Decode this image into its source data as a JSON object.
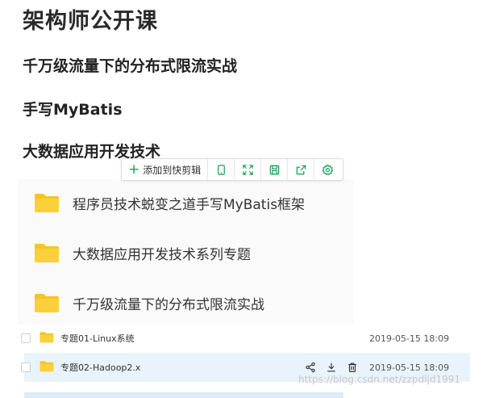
{
  "headings": {
    "title": "架构师公开课",
    "h2a": "千万级流量下的分布式限流实战",
    "h2b": "手写MyBatis",
    "h2c": "大数据应用开发技术"
  },
  "toolbar": {
    "add_label": "添加到快剪辑"
  },
  "folders": [
    {
      "label": "程序员技术蜕变之道手写MyBatis框架"
    },
    {
      "label": "大数据应用开发技术系列专题"
    },
    {
      "label": "千万级流量下的分布式限流实战"
    }
  ],
  "files": [
    {
      "name": "专题01-Linux系统",
      "date": "2019-05-15 18:09"
    },
    {
      "name": "专题02-Hadoop2.x",
      "date": "2019-05-15 18:09"
    }
  ],
  "watermark": "https://blog.csdn.net/zzpdljd1991",
  "colors": {
    "folder": "#f7c325",
    "accent": "#1a9e5a",
    "selected_row": "#e8f3fb"
  }
}
